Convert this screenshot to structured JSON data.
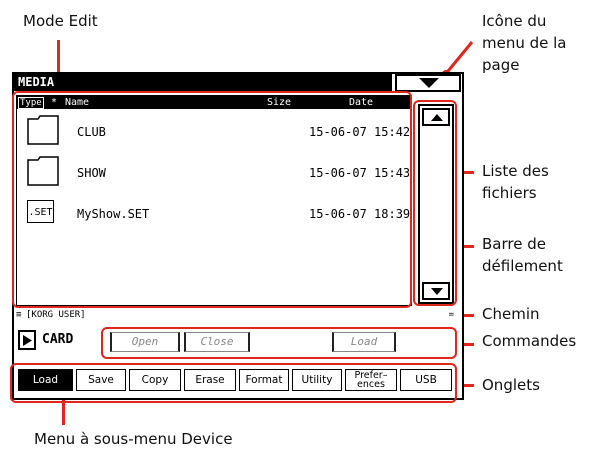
{
  "annotations": {
    "mode_edit": "Mode Edit",
    "page_menu_icon": [
      "Icône du",
      "menu de la",
      "page"
    ],
    "file_list": [
      "Liste des",
      "fichiers"
    ],
    "scrollbar": [
      "Barre de",
      "défilement"
    ],
    "path": "Chemin",
    "commands": "Commandes",
    "tabs": "Onglets",
    "device_menu": "Menu à sous-menu Device"
  },
  "screen": {
    "title": "MEDIA",
    "columns": {
      "type": "Type",
      "star": "*",
      "name": "Name",
      "size": "Size",
      "date": "Date"
    },
    "files": [
      {
        "icon": "folder-icon",
        "name": "CLUB",
        "date": "15-06-07 15:42"
      },
      {
        "icon": "folder-icon",
        "name": "SHOW",
        "date": "15-06-07 15:43"
      },
      {
        "icon": "set-file-icon",
        "icon_text": ".SET",
        "name": "MyShow.SET",
        "date": "15-06-07 18:39"
      }
    ],
    "path": "[KORG USER]",
    "path_end": "=",
    "path_start": "≡",
    "device": "CARD",
    "commands": [
      "Open",
      "Close",
      "Load"
    ],
    "tabs": [
      "Load",
      "Save",
      "Copy",
      "Erase",
      "Format",
      "Utility",
      "Prefer-\nences",
      "USB"
    ],
    "tab_pref_top": "Prefer–",
    "tab_pref_bottom": "ences",
    "active_tab": "Load"
  },
  "colors": {
    "annotation_red": "#e1261c",
    "screen_bg": "#ffffff",
    "header_bg": "#000000"
  }
}
